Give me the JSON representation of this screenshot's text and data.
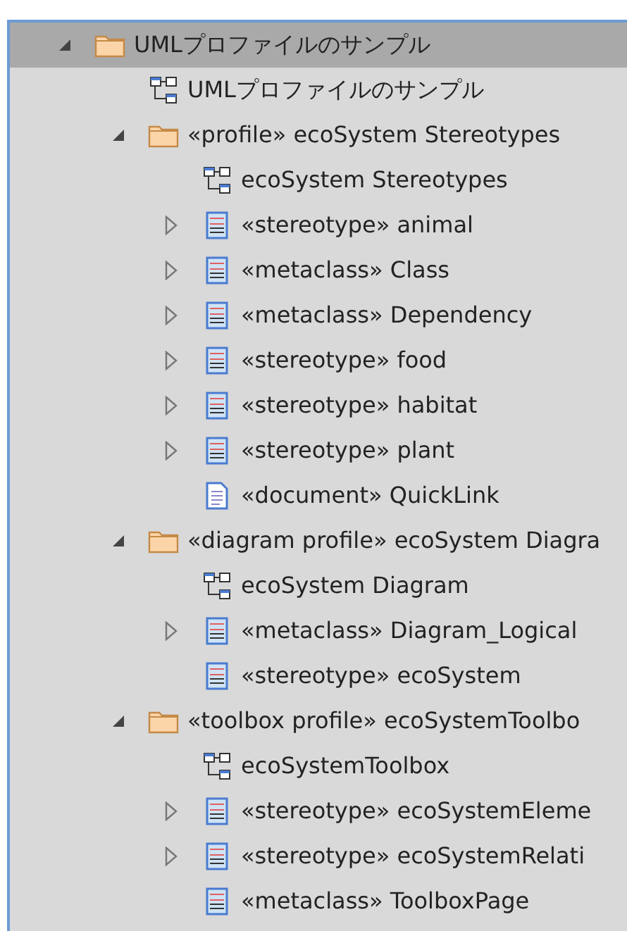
{
  "tree": [
    {
      "label": "UMLプロファイルのサンプル",
      "kind": "folder",
      "expanded": true,
      "selected": true,
      "children": [
        {
          "label": "UMLプロファイルのサンプル",
          "kind": "diagram",
          "selected": false
        },
        {
          "label": "«profile» ecoSystem Stereotypes",
          "kind": "folder",
          "expanded": true,
          "selected": false,
          "children": [
            {
              "label": "ecoSystem Stereotypes",
              "kind": "diagram",
              "selected": false
            },
            {
              "label": "«stereotype» animal",
              "kind": "class",
              "expanded": false,
              "selected": false
            },
            {
              "label": "«metaclass» Class",
              "kind": "class",
              "expanded": false,
              "selected": false
            },
            {
              "label": "«metaclass» Dependency",
              "kind": "class",
              "expanded": false,
              "selected": false
            },
            {
              "label": "«stereotype» food",
              "kind": "class",
              "expanded": false,
              "selected": false
            },
            {
              "label": "«stereotype» habitat",
              "kind": "class",
              "expanded": false,
              "selected": false
            },
            {
              "label": "«stereotype» plant",
              "kind": "class",
              "expanded": false,
              "selected": false
            },
            {
              "label": "«document» QuickLink",
              "kind": "document",
              "selected": false
            }
          ]
        },
        {
          "label": "«diagram profile» ecoSystem Diagra",
          "kind": "folder",
          "expanded": true,
          "selected": false,
          "children": [
            {
              "label": "ecoSystem Diagram",
              "kind": "diagram",
              "selected": false
            },
            {
              "label": "«metaclass» Diagram_Logical",
              "kind": "class",
              "expanded": false,
              "selected": false
            },
            {
              "label": "«stereotype» ecoSystem",
              "kind": "class",
              "selected": false
            }
          ]
        },
        {
          "label": "«toolbox profile» ecoSystemToolbo",
          "kind": "folder",
          "expanded": true,
          "selected": false,
          "children": [
            {
              "label": "ecoSystemToolbox",
              "kind": "diagram",
              "selected": false
            },
            {
              "label": "«stereotype» ecoSystemEleme",
              "kind": "class",
              "expanded": false,
              "selected": false
            },
            {
              "label": "«stereotype» ecoSystemRelati",
              "kind": "class",
              "expanded": false,
              "selected": false
            },
            {
              "label": "«metaclass» ToolboxPage",
              "kind": "class",
              "selected": false
            }
          ]
        }
      ]
    }
  ]
}
